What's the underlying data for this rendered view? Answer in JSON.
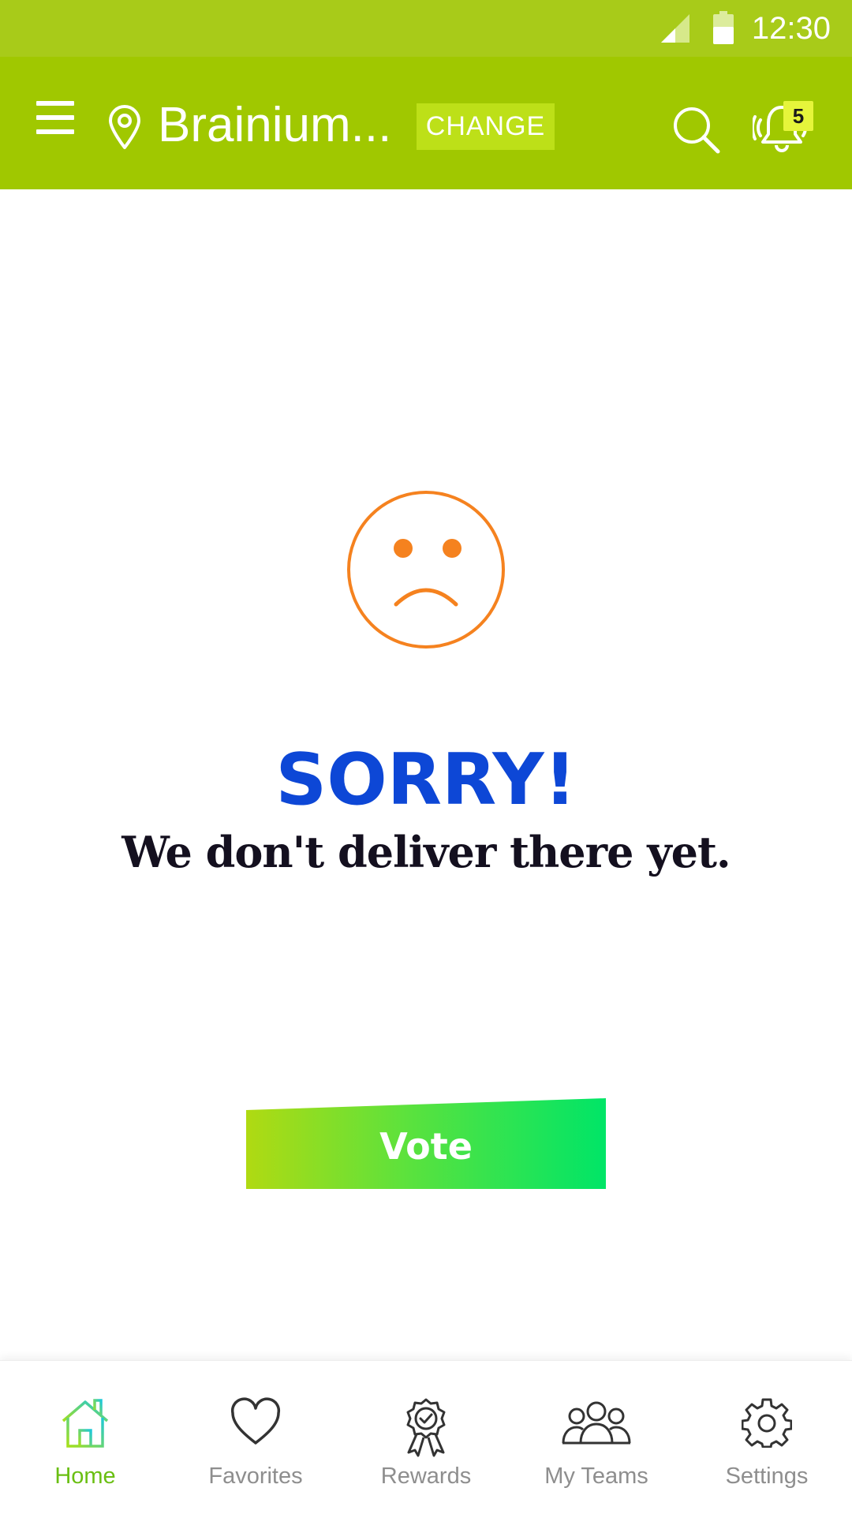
{
  "status_bar": {
    "time": "12:30",
    "icons": [
      "signal-icon",
      "battery-icon"
    ]
  },
  "header": {
    "location": "Brainium...",
    "change_label": "CHANGE",
    "notification_count": "5",
    "icons": [
      "menu-icon",
      "location-pin-icon",
      "search-icon",
      "bell-icon"
    ]
  },
  "main": {
    "icon": "sad-face-icon",
    "title": "SORRY!",
    "subtitle": "We don't deliver there yet.",
    "vote_label": "Vote"
  },
  "bottom_nav": {
    "active": "Home",
    "items": [
      {
        "label": "Home",
        "icon": "home-icon"
      },
      {
        "label": "Favorites",
        "icon": "heart-icon"
      },
      {
        "label": "Rewards",
        "icon": "award-icon"
      },
      {
        "label": "My Teams",
        "icon": "team-icon"
      },
      {
        "label": "Settings",
        "icon": "gear-icon"
      }
    ]
  },
  "colors": {
    "status_bar": "#a8cb19",
    "header": "#a0c800",
    "change_button": "#bde018",
    "badge": "#e6f53b",
    "sad_face": "#f5821f",
    "title": "#0d47d6",
    "subtitle": "#14101f",
    "vote_gradient_start": "#b0da12",
    "vote_gradient_end": "#00e567",
    "nav_active": "#6abf12",
    "nav_inactive": "#8e8e8e"
  }
}
